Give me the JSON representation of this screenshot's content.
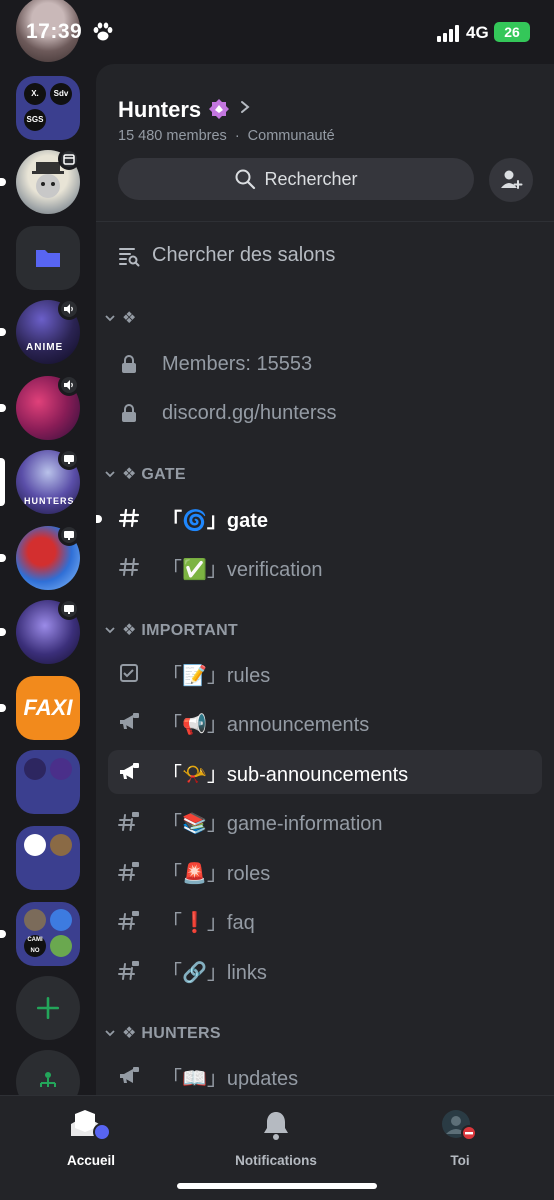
{
  "status_bar": {
    "time": "17:39",
    "network": "4G",
    "battery": "26"
  },
  "server": {
    "name": "Hunters",
    "members": "15 480 membres",
    "type": "Communauté",
    "separator": "·"
  },
  "search": {
    "label": "Rechercher"
  },
  "browse": {
    "label": "Chercher des salons"
  },
  "categories": {
    "unnamed": "❖",
    "gate": "❖ GATE",
    "important": "❖ IMPORTANT",
    "hunters": "❖ HUNTERS"
  },
  "channels": {
    "members": "Members: 15553",
    "invite": "discord.gg/hunterss",
    "gate": "「🌀」gate",
    "verification": "「✅」verification",
    "rules": "「📝」rules",
    "announcements": "「📢」announcements",
    "sub_announcements": "「📯」sub-announcements",
    "game_information": "「📚」game-information",
    "roles": "「🚨」roles",
    "faq": "「❗」faq",
    "links": "「🔗」links",
    "updates": "「📖」updates"
  },
  "rail": {
    "folder1": {
      "a": "X.",
      "b": "Sdv",
      "c": "SGS"
    },
    "faxi": "FAXI",
    "anime": "ANIME",
    "hunters_art": "HUNTERS",
    "cami": "CAMI NO"
  },
  "tabbar": {
    "home": "Accueil",
    "notifications": "Notifications",
    "you": "Toi"
  },
  "colors": {
    "background": "#1a1a1e",
    "panel": "#232428",
    "accent": "#5865f2",
    "green": "#23a55a",
    "battery": "#34c759"
  }
}
